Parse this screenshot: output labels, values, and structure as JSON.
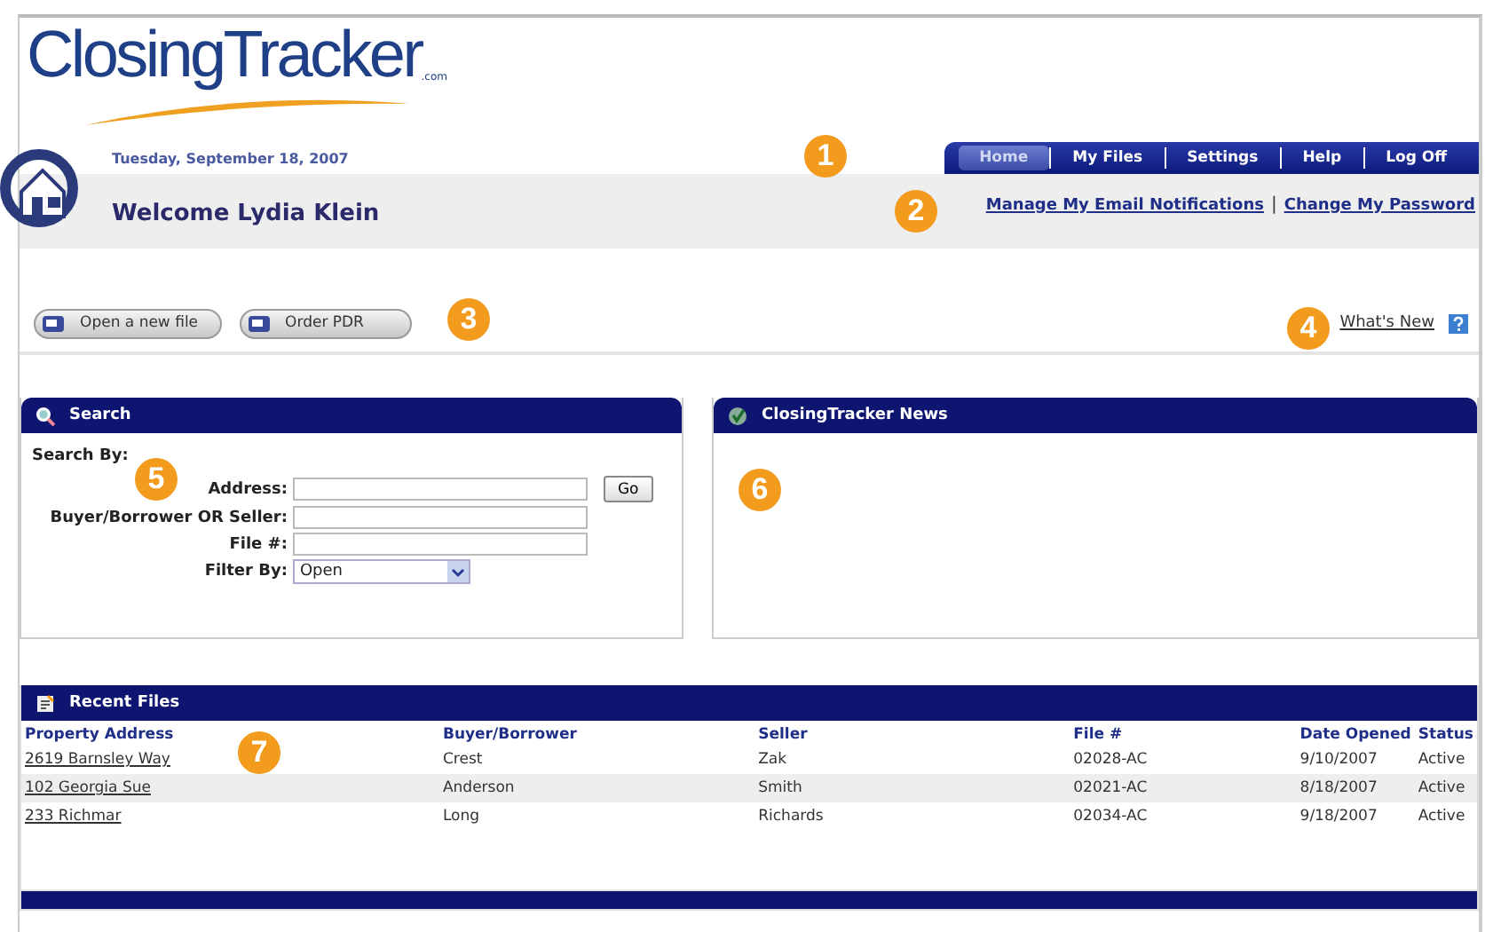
{
  "logo": {
    "name": "ClosingTracker",
    "suffix": ".com"
  },
  "date": "Tuesday, September 18, 2007",
  "tabs": [
    {
      "label": "Home",
      "selected": true
    },
    {
      "label": "My Files",
      "selected": false
    },
    {
      "label": "Settings",
      "selected": false
    },
    {
      "label": "Help",
      "selected": false
    },
    {
      "label": "Log Off",
      "selected": false
    }
  ],
  "welcome": "Welcome Lydia Klein",
  "account_links": [
    "Manage My Email Notifications",
    "Change My Password"
  ],
  "account_links_separator": "|",
  "action_buttons": [
    "Open a new file",
    "Order PDR"
  ],
  "whats_new": "What's New",
  "search": {
    "title": "Search",
    "search_by": "Search By:",
    "fields": [
      {
        "label": "Address:"
      },
      {
        "label": "Buyer/Borrower OR Seller:"
      },
      {
        "label": "File #:"
      }
    ],
    "go": "Go",
    "filter_label": "Filter By:",
    "filter_value": "Open"
  },
  "news": {
    "title": "ClosingTracker News"
  },
  "recent_files": {
    "title": "Recent Files",
    "columns": [
      "Property Address",
      "Buyer/Borrower",
      "Seller",
      "File #",
      "Date Opened",
      "Status"
    ],
    "rows": [
      [
        "2619 Barnsley Way",
        "Crest",
        "Zak",
        "02028-AC",
        "9/10/2007",
        "Active"
      ],
      [
        "102 Georgia Sue",
        "Anderson",
        "Smith",
        "02021-AC",
        "8/18/2007",
        "Active"
      ],
      [
        "233 Richmar",
        "Long",
        "Richards",
        "02034-AC",
        "9/18/2007",
        "Active"
      ]
    ]
  },
  "callouts": [
    "1",
    "2",
    "3",
    "4",
    "5",
    "6",
    "7"
  ]
}
